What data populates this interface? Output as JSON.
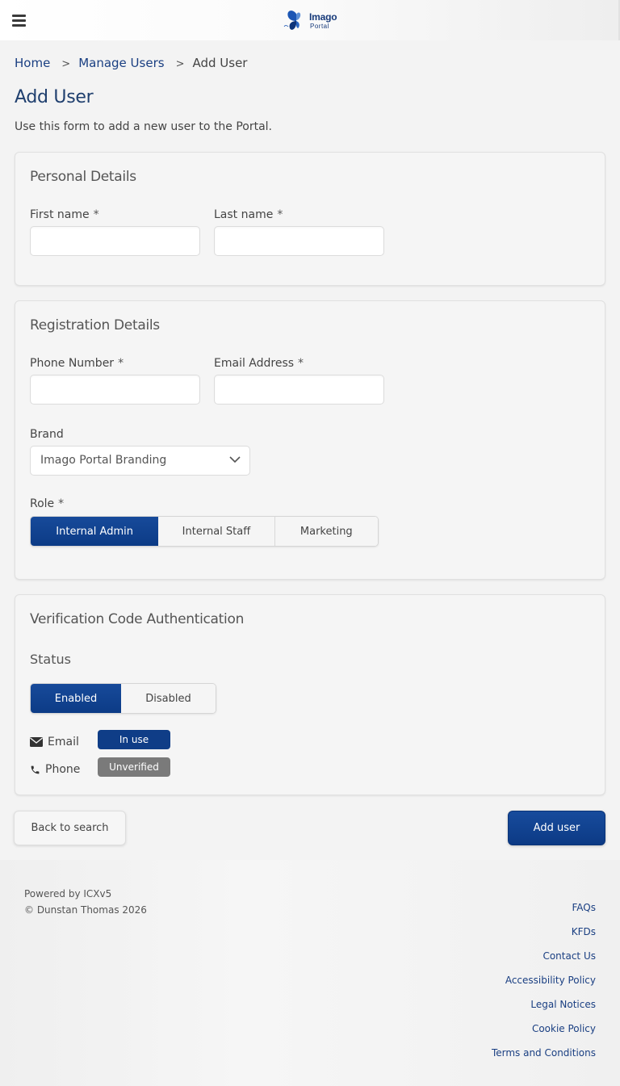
{
  "header": {
    "logo_line1": "Imago",
    "logo_line2": "Portal"
  },
  "breadcrumb": {
    "home": "Home",
    "manage_users": "Manage Users",
    "current": "Add User",
    "separator": ">"
  },
  "page": {
    "title": "Add User",
    "description": "Use this form to add a new user to the Portal."
  },
  "personal_details": {
    "title": "Personal Details",
    "first_name_label": "First name",
    "first_name_value": "",
    "last_name_label": "Last name",
    "last_name_value": "",
    "required_marker": "*"
  },
  "registration_details": {
    "title": "Registration Details",
    "phone_label": "Phone Number",
    "phone_value": "",
    "email_label": "Email Address",
    "email_value": "",
    "brand_label": "Brand",
    "brand_selected": "Imago Portal Branding",
    "role_label": "Role",
    "roles": [
      {
        "label": "Internal Admin",
        "active": true
      },
      {
        "label": "Internal Staff",
        "active": false
      },
      {
        "label": "Marketing",
        "active": false
      }
    ],
    "required_marker": "*"
  },
  "verification": {
    "title": "Verification Code Authentication",
    "status_label": "Status",
    "status_options": [
      {
        "label": "Enabled",
        "active": true
      },
      {
        "label": "Disabled",
        "active": false
      }
    ],
    "methods": [
      {
        "label": "Email",
        "icon": "envelope-icon",
        "badge": "In use",
        "badge_color": "#0f3d87"
      },
      {
        "label": "Phone",
        "icon": "phone-icon",
        "badge": "Unverified",
        "badge_color": "#7a7a7a"
      }
    ]
  },
  "actions": {
    "back_label": "Back to search",
    "add_label": "Add user"
  },
  "footer": {
    "powered_by": "Powered by ICXv5",
    "copyright": "© Dunstan Thomas 2026",
    "links": [
      "FAQs",
      "KFDs",
      "Contact Us",
      "Accessibility Policy",
      "Legal Notices",
      "Cookie Policy",
      "Terms and Conditions"
    ]
  },
  "colors": {
    "primary": "#0f3d87",
    "link": "#1a3f82",
    "badge_unverified": "#7a7a7a"
  }
}
